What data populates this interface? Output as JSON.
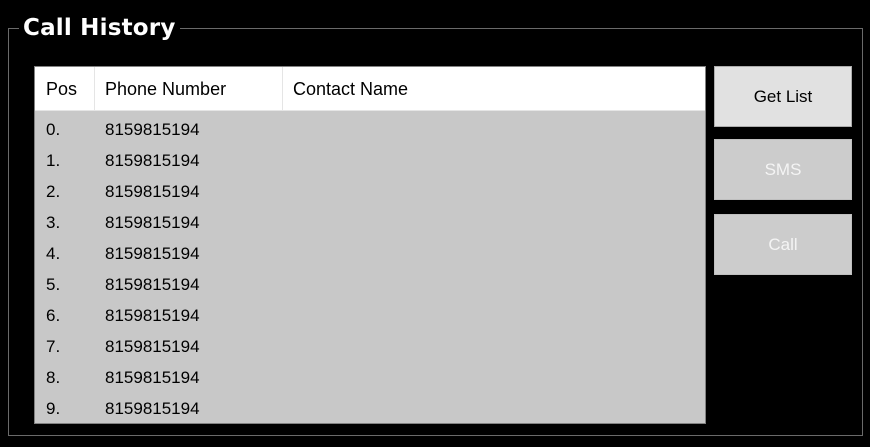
{
  "call_history": {
    "title": "Call History",
    "columns": [
      "Pos",
      "Phone Number",
      "Contact Name"
    ],
    "rows": [
      {
        "pos": "0.",
        "phone": "8159815194",
        "contact": ""
      },
      {
        "pos": "1.",
        "phone": "8159815194",
        "contact": ""
      },
      {
        "pos": "2.",
        "phone": "8159815194",
        "contact": ""
      },
      {
        "pos": "3.",
        "phone": "8159815194",
        "contact": ""
      },
      {
        "pos": "4.",
        "phone": "8159815194",
        "contact": ""
      },
      {
        "pos": "5.",
        "phone": "8159815194",
        "contact": ""
      },
      {
        "pos": "6.",
        "phone": "8159815194",
        "contact": ""
      },
      {
        "pos": "7.",
        "phone": "8159815194",
        "contact": ""
      },
      {
        "pos": "8.",
        "phone": "8159815194",
        "contact": ""
      },
      {
        "pos": "9.",
        "phone": "8159815194",
        "contact": ""
      }
    ]
  },
  "buttons": {
    "get_list": {
      "label": "Get List",
      "enabled": true
    },
    "sms": {
      "label": "SMS",
      "enabled": false
    },
    "call": {
      "label": "Call",
      "enabled": false
    }
  },
  "colors": {
    "background": "#000000",
    "list_background": "#c8c8c8",
    "header_background": "#ffffff",
    "button_enabled": "#e1e1e1",
    "button_disabled": "#cccccc"
  }
}
